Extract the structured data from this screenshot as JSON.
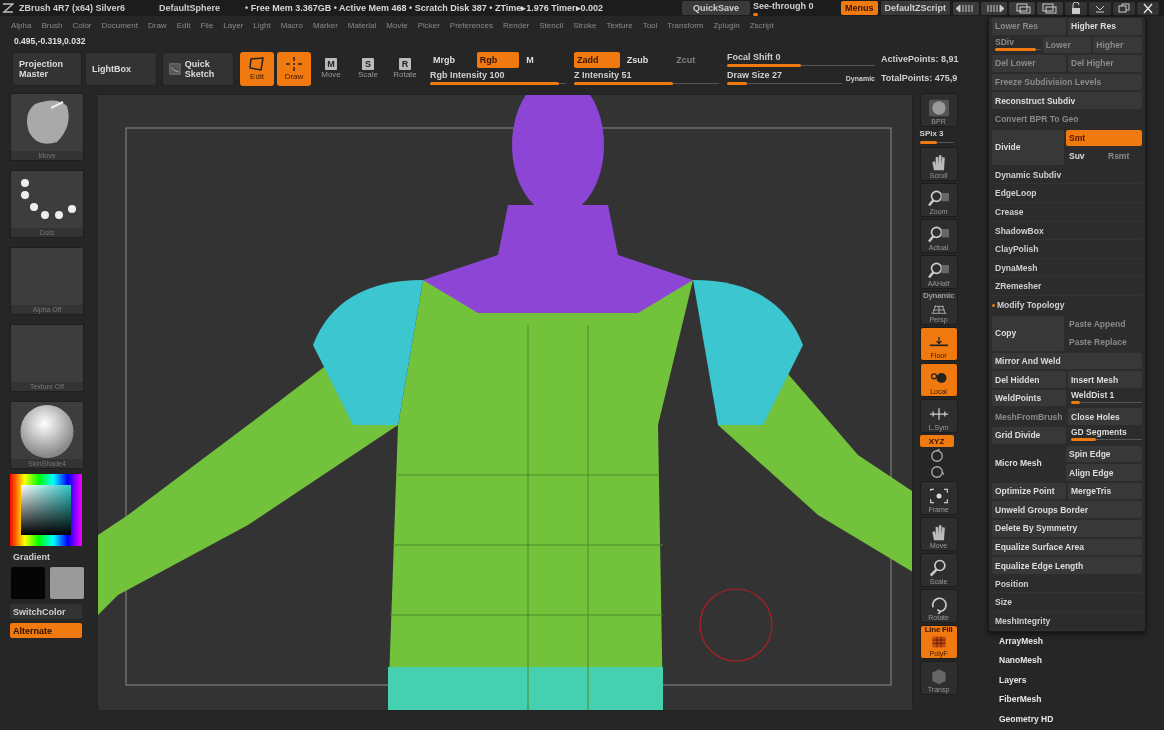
{
  "title_bar": {
    "app": "ZBrush 4R7 (x64) Silver6",
    "document": "DefaultSphere",
    "stats": "• Free Mem 3.367GB • Active Mem 468 • Scratch Disk 387 • ZTime▸1.976 Timer▸0.002",
    "quicksave": "QuickSave",
    "see_through": {
      "label": "See-through 0",
      "level": 0.06
    },
    "menus": {
      "label": "Menus",
      "on": true
    },
    "script": "DefaultZScript"
  },
  "menu_bar": [
    "Alpha",
    "Brush",
    "Color",
    "Document",
    "Draw",
    "Edit",
    "File",
    "Layer",
    "Light",
    "Macro",
    "Marker",
    "Material",
    "Movie",
    "Picker",
    "Preferences",
    "Render",
    "Stencil",
    "Stroke",
    "Texture",
    "Tool",
    "Transform",
    "Zplugin",
    "Zscript"
  ],
  "coordinates": "0.495,-0.319,0.032",
  "toolbar": {
    "projection_master": "Projection Master",
    "lightbox": "LightBox",
    "quick_sketch": "Quick Sketch",
    "modes": [
      {
        "kind": "edit",
        "label": "Edit",
        "on": true
      },
      {
        "kind": "draw",
        "label": "Draw",
        "on": true
      },
      {
        "kind": "key",
        "key": "M",
        "label": "Move",
        "on": false
      },
      {
        "kind": "key",
        "key": "S",
        "label": "Scale",
        "on": false
      },
      {
        "kind": "key",
        "key": "R",
        "label": "Rotate",
        "on": false
      }
    ],
    "color_modes": [
      {
        "label": "Mrgb",
        "on": false
      },
      {
        "label": "Rgb",
        "on": true
      },
      {
        "label": "M",
        "on": false
      }
    ],
    "rgb_intensity": {
      "label": "Rgb Intensity 100",
      "level": 0.95
    },
    "z_modes": [
      {
        "label": "Zadd",
        "on": true,
        "disabled": false
      },
      {
        "label": "Zsub",
        "on": false,
        "disabled": false
      },
      {
        "label": "Zcut",
        "on": false,
        "disabled": true
      }
    ],
    "z_intensity": {
      "label": "Z Intensity 51",
      "level": 0.68
    },
    "focal_shift": {
      "label": "Focal Shift 0",
      "level": 0.5
    },
    "draw_size": {
      "label": "Draw Size 27",
      "level": 0.17
    },
    "dynamic": "Dynamic",
    "active_points": "ActivePoints: 8,91",
    "total_points": "TotalPoints: 475,9"
  },
  "left_shelf": {
    "thumbs": [
      {
        "kind": "brush",
        "label": "Move"
      },
      {
        "kind": "stroke",
        "label": "Dots"
      },
      {
        "kind": "empty",
        "label": "Alpha Off"
      },
      {
        "kind": "empty",
        "label": "Texture Off"
      },
      {
        "kind": "material",
        "label": "SkinShade4"
      }
    ],
    "gradient": "Gradient",
    "swatches": [
      {
        "color": "#050505"
      },
      {
        "color": "#9a9a9a"
      }
    ],
    "switch_color": "SwitchColor",
    "alternate": {
      "label": "Alternate",
      "on": true
    }
  },
  "right_shelf": [
    {
      "kind": "bpr",
      "label": "BPR",
      "on": false
    },
    {
      "kind": "slider",
      "label": "SPix 3",
      "level": 0.5
    },
    {
      "kind": "scroll",
      "label": "Scroll",
      "on": false
    },
    {
      "kind": "zoom",
      "label": "Zoom",
      "on": false
    },
    {
      "kind": "actual",
      "label": "Actual",
      "on": false
    },
    {
      "kind": "aahalf",
      "label": "AAHalf",
      "on": false
    },
    {
      "kind": "persp",
      "top": "Dynamic",
      "label": "Persp",
      "on": false
    },
    {
      "kind": "floor",
      "label": "Floor",
      "on": true
    },
    {
      "kind": "local",
      "label": "Local",
      "on": true
    },
    {
      "kind": "lsym",
      "label": "L.Sym",
      "on": false
    },
    {
      "kind": "xyz",
      "label": "XYZ",
      "on": true
    },
    {
      "kind": "roty"
    },
    {
      "kind": "rotz"
    },
    {
      "kind": "frame",
      "label": "Frame",
      "on": false
    },
    {
      "kind": "move",
      "label": "Move",
      "on": false
    },
    {
      "kind": "scale",
      "label": "Scale",
      "on": false
    },
    {
      "kind": "rotate",
      "label": "Rotate",
      "on": false
    },
    {
      "kind": "polyf",
      "top": "Line Fill",
      "label": "PolyF",
      "on": true
    },
    {
      "kind": "transp",
      "label": "Transp",
      "on": false
    }
  ],
  "tool_panel": {
    "rows": [
      {
        "kind": "line",
        "cells": [
          {
            "kind": "button",
            "label": "Lower Res",
            "disabled": true
          },
          {
            "kind": "button",
            "label": "Higher Res",
            "disabled": false
          }
        ]
      },
      {
        "kind": "line",
        "cells": [
          {
            "kind": "slider",
            "label": "SDiv",
            "disabled": true,
            "level": 0.9
          },
          {
            "kind": "button",
            "label": "Lower",
            "disabled": true
          },
          {
            "kind": "button",
            "label": "Higher",
            "disabled": true
          }
        ]
      },
      {
        "kind": "line",
        "cells": [
          {
            "kind": "button",
            "label": "Del Lower",
            "disabled": true
          },
          {
            "kind": "button",
            "label": "Del Higher",
            "disabled": true
          }
        ]
      },
      {
        "kind": "line",
        "cells": [
          {
            "kind": "button",
            "label": "Freeze Subdivision Levels",
            "disabled": true
          }
        ]
      },
      {
        "kind": "line",
        "cells": [
          {
            "kind": "button",
            "label": "Reconstruct Subdiv",
            "disabled": false
          }
        ]
      },
      {
        "kind": "line",
        "cells": [
          {
            "kind": "text",
            "label": "Convert BPR To Geo",
            "disabled": true
          }
        ]
      },
      {
        "kind": "split",
        "main": {
          "kind": "button",
          "label": "Divide"
        },
        "side": [
          [
            {
              "kind": "button",
              "label": "Smt",
              "on": true
            }
          ],
          [
            {
              "kind": "text",
              "label": "Suv"
            },
            {
              "kind": "text",
              "label": "Rsmt",
              "disabled": true
            }
          ]
        ]
      },
      {
        "kind": "item",
        "label": "Dynamic Subdiv"
      },
      {
        "kind": "item",
        "label": "EdgeLoop"
      },
      {
        "kind": "item",
        "label": "Crease"
      },
      {
        "kind": "item",
        "label": "ShadowBox"
      },
      {
        "kind": "item",
        "label": "ClayPolish"
      },
      {
        "kind": "item",
        "label": "DynaMesh"
      },
      {
        "kind": "item",
        "label": "ZRemesher"
      },
      {
        "kind": "section",
        "label": "Modify Topology"
      },
      {
        "kind": "split",
        "main": {
          "kind": "button",
          "label": "Copy"
        },
        "side": [
          [
            {
              "kind": "text",
              "label": "Paste Append",
              "disabled": true
            }
          ],
          [
            {
              "kind": "text",
              "label": "Paste Replace",
              "disabled": true
            }
          ]
        ]
      },
      {
        "kind": "line",
        "cells": [
          {
            "kind": "button",
            "label": "Mirror And Weld"
          }
        ]
      },
      {
        "kind": "line",
        "cells": [
          {
            "kind": "button",
            "label": "Del Hidden"
          },
          {
            "kind": "button",
            "label": "Insert Mesh"
          }
        ]
      },
      {
        "kind": "line",
        "cells": [
          {
            "kind": "button",
            "label": "WeldPoints"
          },
          {
            "kind": "slider",
            "label": "WeldDist 1",
            "level": 0.12
          }
        ]
      },
      {
        "kind": "line",
        "cells": [
          {
            "kind": "text",
            "label": "MeshFromBrush",
            "disabled": true
          },
          {
            "kind": "button",
            "label": "Close Holes"
          }
        ]
      },
      {
        "kind": "line",
        "cells": [
          {
            "kind": "button",
            "label": "Grid Divide"
          },
          {
            "kind": "slider",
            "label": "GD Segments",
            "level": 0.35
          }
        ]
      },
      {
        "kind": "split",
        "main": {
          "kind": "text",
          "label": "Micro Mesh"
        },
        "side": [
          [
            {
              "kind": "button",
              "label": "Spin Edge"
            }
          ],
          [
            {
              "kind": "button",
              "label": "Align Edge"
            }
          ]
        ]
      },
      {
        "kind": "line",
        "cells": [
          {
            "kind": "button",
            "label": "Optimize Point"
          },
          {
            "kind": "button",
            "label": "MergeTris"
          }
        ]
      },
      {
        "kind": "line",
        "cells": [
          {
            "kind": "button",
            "label": "Unweld Groups Border"
          }
        ]
      },
      {
        "kind": "line",
        "cells": [
          {
            "kind": "button",
            "label": "Delete By Symmetry"
          }
        ]
      },
      {
        "kind": "line",
        "cells": [
          {
            "kind": "button",
            "label": "Equalize Surface Area"
          }
        ]
      },
      {
        "kind": "line",
        "cells": [
          {
            "kind": "button",
            "label": "Equalize Edge Length"
          }
        ]
      },
      {
        "kind": "item",
        "label": "Position"
      },
      {
        "kind": "item",
        "label": "Size"
      },
      {
        "kind": "item",
        "label": "MeshIntegrity"
      }
    ]
  },
  "subpalettes": [
    "ArrayMesh",
    "NanoMesh",
    "Layers",
    "FiberMesh",
    "Geometry HD"
  ]
}
